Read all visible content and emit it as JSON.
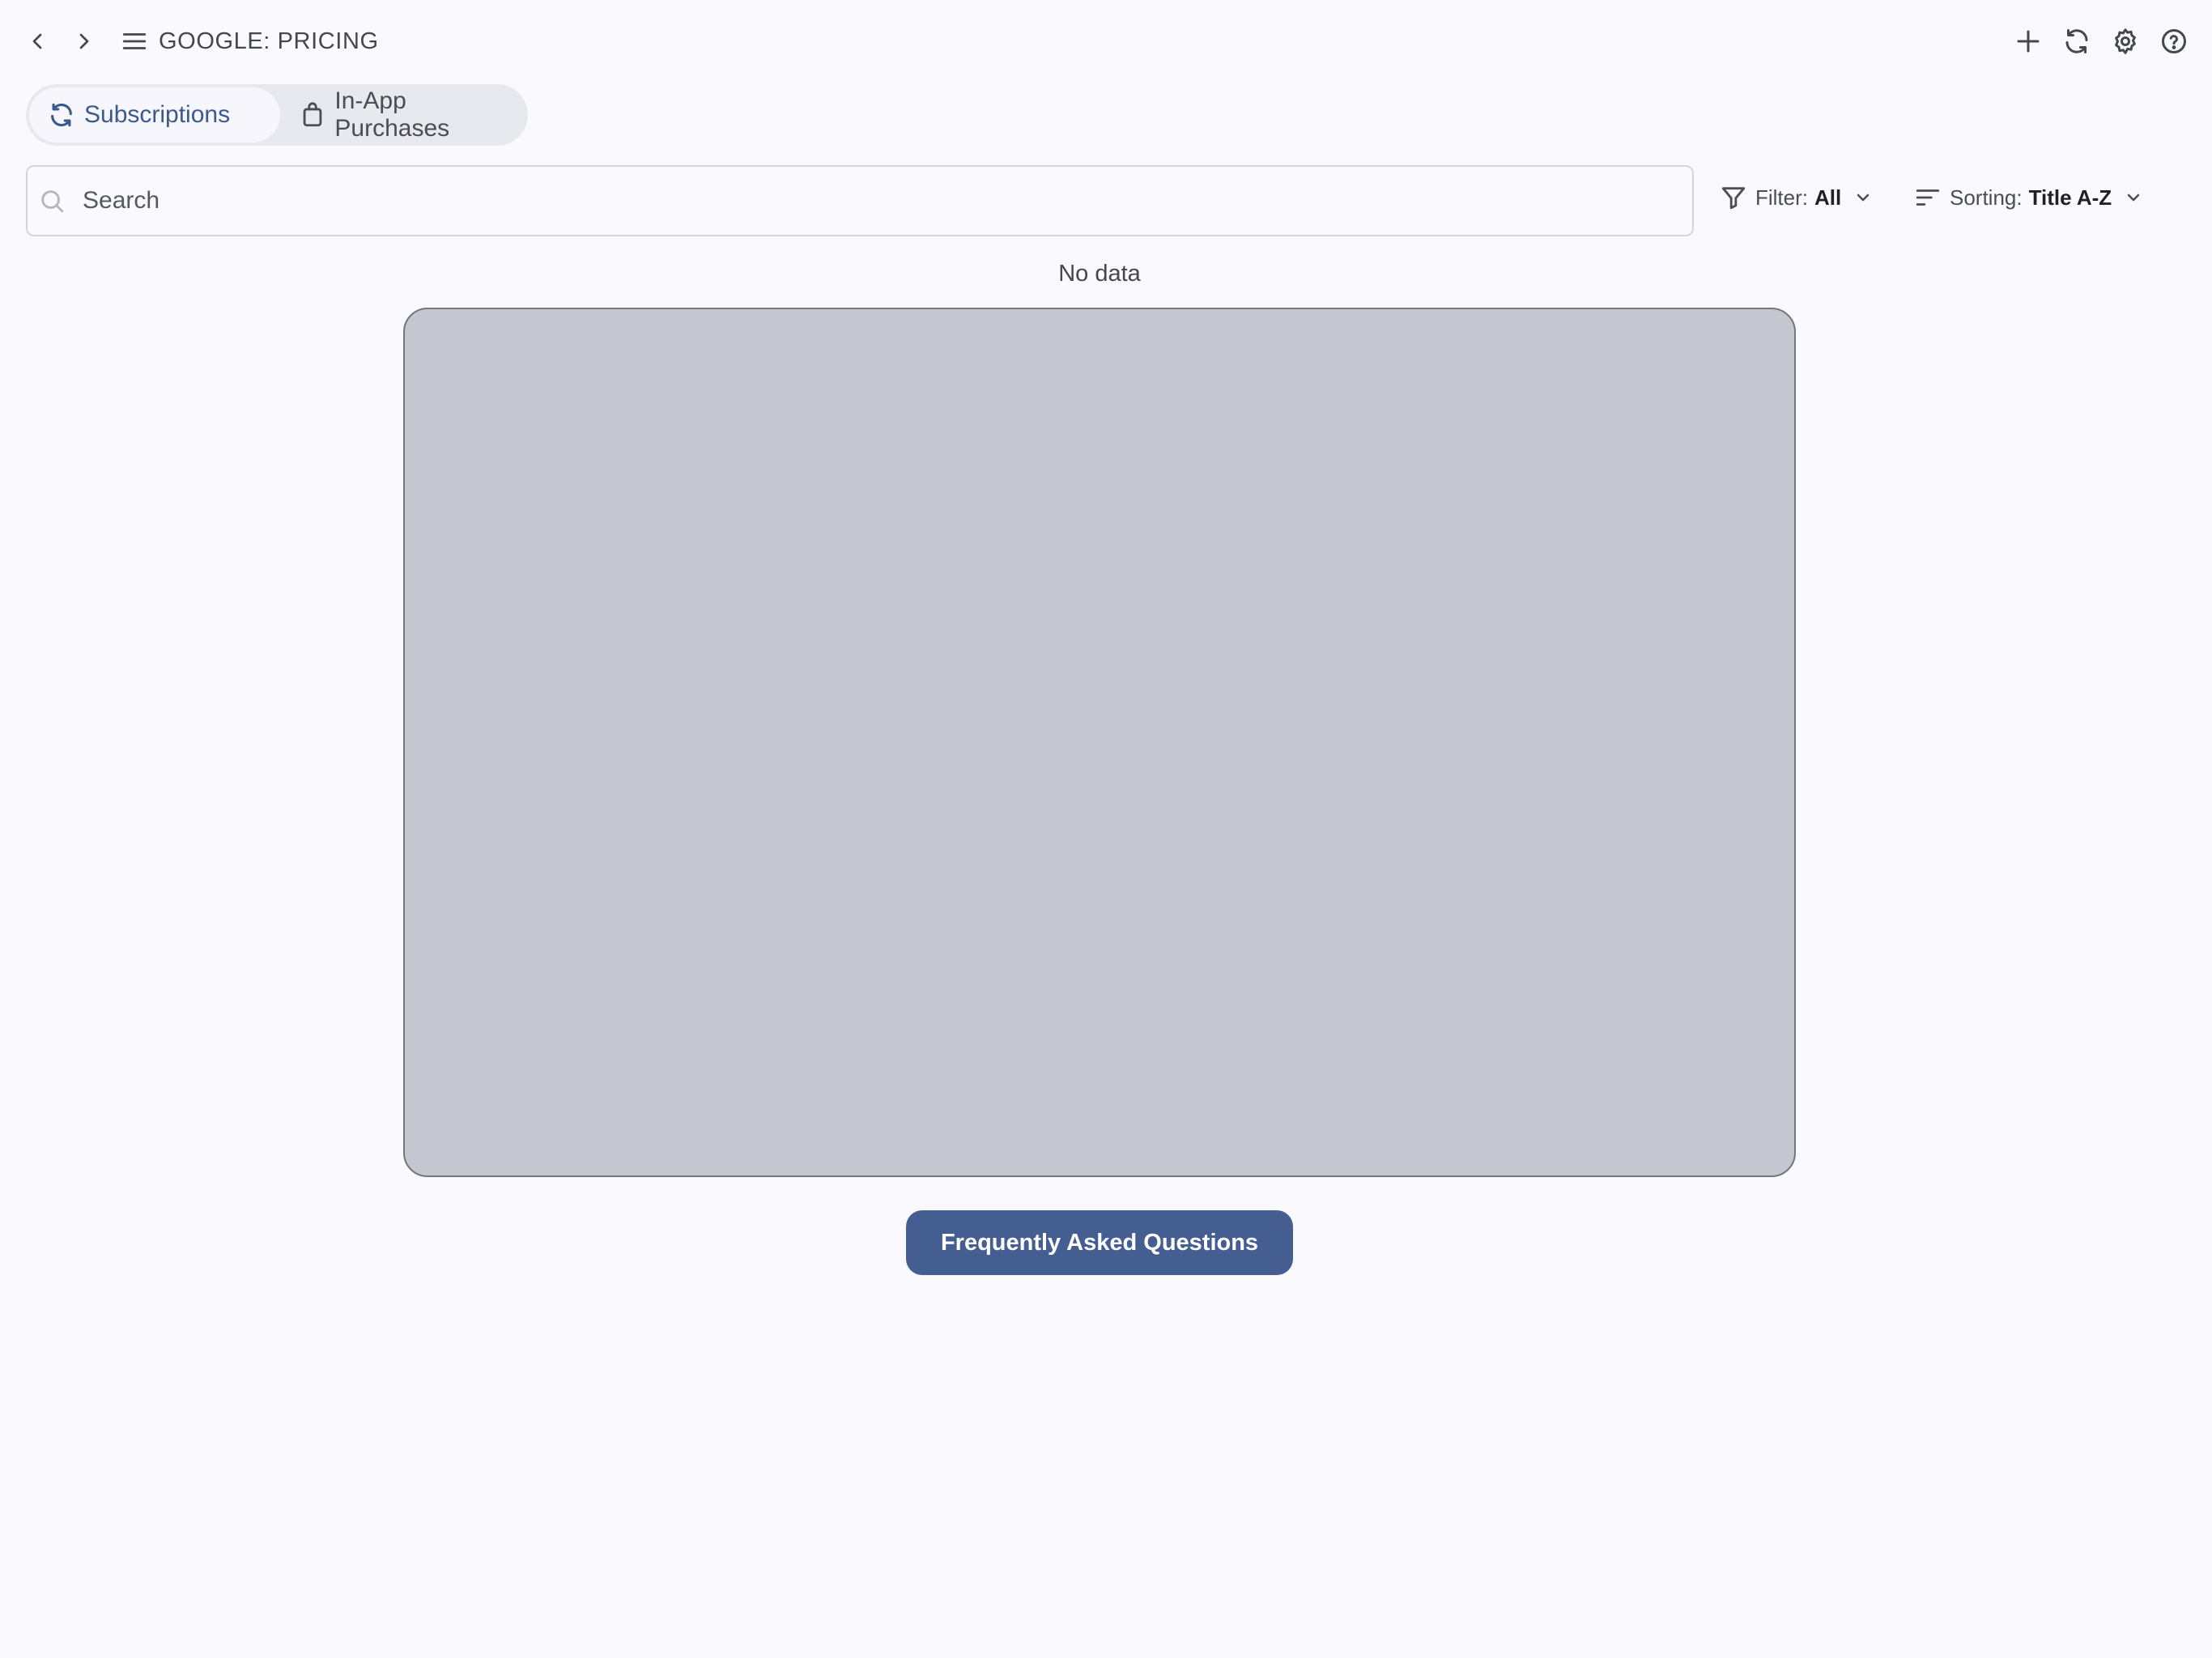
{
  "header": {
    "title": "GOOGLE: PRICING",
    "back_icon": "chevron-left-icon",
    "forward_icon": "chevron-right-icon",
    "menu_icon": "menu-icon",
    "actions": [
      "plus-icon",
      "refresh-icon",
      "gear-icon",
      "help-circle-icon"
    ]
  },
  "tabs": [
    {
      "label": "Subscriptions",
      "icon": "refresh-icon",
      "active": true
    },
    {
      "label": "In-App Purchases",
      "icon": "shopping-bag-icon",
      "active": false
    }
  ],
  "search": {
    "placeholder": "Search",
    "value": ""
  },
  "filter": {
    "label": "Filter:",
    "value": "All"
  },
  "sorting": {
    "label": "Sorting:",
    "value": "Title A-Z"
  },
  "content": {
    "empty_message": "No data"
  },
  "faq_button": {
    "label": "Frequently Asked Questions"
  },
  "colors": {
    "background": "#f9f9fe",
    "accent": "#445e92",
    "active_tab_text": "#3a5a8c",
    "panel_fill": "#c4c7cf"
  }
}
